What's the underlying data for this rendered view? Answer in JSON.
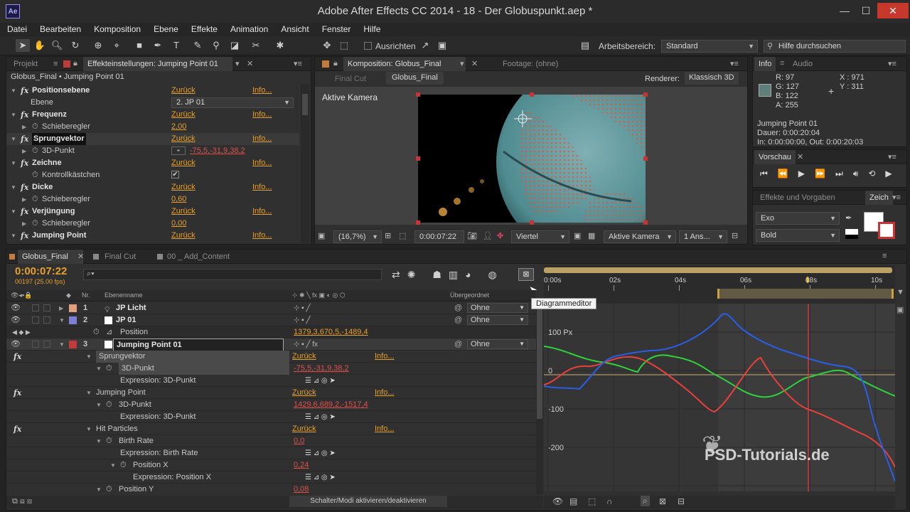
{
  "window": {
    "app_logo": "Ae",
    "title": "Adobe After Effects CC 2014 - 18 - Der Globuspunkt.aep *",
    "minimize": "—",
    "maximize": "☐",
    "close": "✕"
  },
  "menu": [
    "Datei",
    "Bearbeiten",
    "Komposition",
    "Ebene",
    "Effekte",
    "Animation",
    "Ansicht",
    "Fenster",
    "Hilfe"
  ],
  "toolbar": {
    "ausrichten_label": "Ausrichten",
    "arbeitsbereich_label": "Arbeitsbereich:",
    "arbeitsbereich_value": "Standard",
    "search_placeholder": "Hilfe durchsuchen"
  },
  "effects_panel": {
    "tab_projekt": "Projekt",
    "tab_effekteinstellungen": "Effekteinstellungen: Jumping Point 01",
    "breadcrumb": "Globus_Final • Jumping Point 01",
    "rows": [
      {
        "kind": "fx",
        "name": "Positionsebene",
        "reset": "Zurück",
        "info": "Info..."
      },
      {
        "kind": "prop",
        "name": "Ebene",
        "value": "2. JP 01"
      },
      {
        "kind": "fx",
        "name": "Frequenz",
        "reset": "Zurück",
        "info": "Info..."
      },
      {
        "kind": "sub",
        "name": "Schieberegler",
        "value": "2,00"
      },
      {
        "kind": "fx",
        "name": "Sprungvektor",
        "reset": "Zurück",
        "info": "Info..."
      },
      {
        "kind": "sub",
        "name": "3D-Punkt",
        "value": "-75,5,-31,9,38,2"
      },
      {
        "kind": "fx",
        "name": "Zeichne",
        "reset": "Zurück",
        "info": "Info..."
      },
      {
        "kind": "sub",
        "name": "Kontrollkästchen",
        "value": "✔"
      },
      {
        "kind": "fx",
        "name": "Dicke",
        "reset": "Zurück",
        "info": "Info..."
      },
      {
        "kind": "sub",
        "name": "Schieberegler",
        "value": "0,60"
      },
      {
        "kind": "fx",
        "name": "Verjüngung",
        "reset": "Zurück",
        "info": "Info..."
      },
      {
        "kind": "sub",
        "name": "Schieberegler",
        "value": "0,00"
      },
      {
        "kind": "fx",
        "name": "Jumping Point",
        "reset": "Zurück",
        "info": "Info..."
      }
    ]
  },
  "comp_panel": {
    "tab_komposition": "Komposition: Globus_Final",
    "tab_footage": "Footage: (ohne)",
    "crumb_final_cut": "Final Cut",
    "crumb_globus": "Globus_Final",
    "renderer_label": "Renderer:",
    "renderer_value": "Klassisch 3D",
    "active_camera_label": "Aktive Kamera",
    "zoom": "(16,7%)",
    "timecode": "0:00:07:22",
    "resolution": "Viertel",
    "camera": "Aktive Kamera",
    "views": "1 Ans..."
  },
  "info_panel": {
    "tab_info": "Info",
    "tab_audio": "Audio",
    "r": "R:  97",
    "g": "G:  127",
    "b": "B:  122",
    "a": "A:  255",
    "x": "X : 971",
    "y": "Y : 311",
    "swatch_color": "#617f7a",
    "layer_name": "Jumping Point 01",
    "dauer": "Dauer: 0:00:20:04",
    "in_out": "In: 0:00:00:00,  Out: 0:00:20:03"
  },
  "preview_panel": {
    "tab": "Vorschau"
  },
  "char_panel": {
    "tab_effects": "Effekte und Vorgaben",
    "tab_zeichen": "Zeich",
    "font": "Exo",
    "style": "Bold"
  },
  "timeline": {
    "tabs": [
      "Globus_Final",
      "Final Cut",
      "00 _ Add_Content"
    ],
    "timecode": "0:00:07:22",
    "frames": "00197 (25.00 fps)",
    "search_placeholder": "⌕▾",
    "col_nr": "Nr.",
    "col_name": "Ebenenname",
    "col_parent": "Übergeordnet",
    "tooltip": "Diagrammeditor",
    "bottom_toggle": "Schalter/Modi aktivieren/deaktivieren",
    "layers": [
      {
        "nr": "1",
        "name": "JP Licht",
        "color": "#e0a080",
        "parent": "Ohne"
      },
      {
        "nr": "2",
        "name": "JP 01",
        "color": "#7b7fd6",
        "parent": "Ohne"
      },
      {
        "nr": "3",
        "name": "Jumping Point 01",
        "color": "#c23b3b",
        "parent": "Ohne"
      }
    ],
    "position_label": "Position",
    "position_value": "1379,3,670,5,-1489,4",
    "props": [
      {
        "indent": 1,
        "kind": "fx",
        "name": "Sprungvektor",
        "reset": "Zurück",
        "info": "Info..."
      },
      {
        "indent": 2,
        "kind": "prop",
        "name": "3D-Punkt",
        "value": "-75,5,-31,9,38,2"
      },
      {
        "indent": 3,
        "kind": "expr",
        "name": "Expression: 3D-Punkt"
      },
      {
        "indent": 1,
        "kind": "fx",
        "name": "Jumping Point",
        "reset": "Zurück",
        "info": "Info..."
      },
      {
        "indent": 2,
        "kind": "prop",
        "name": "3D-Punkt",
        "value": "1429,6,689,2,-1517,4"
      },
      {
        "indent": 3,
        "kind": "expr",
        "name": "Expression: 3D-Punkt"
      },
      {
        "indent": 1,
        "kind": "fx",
        "name": "Hit Particles",
        "reset": "Zurück",
        "info": "Info..."
      },
      {
        "indent": 2,
        "kind": "prop",
        "name": "Birth Rate",
        "value": "0,0"
      },
      {
        "indent": 3,
        "kind": "expr",
        "name": "Expression: Birth Rate"
      },
      {
        "indent": 2,
        "kind": "prop",
        "name": "Position X",
        "value": "0,24"
      },
      {
        "indent": 4,
        "kind": "expr",
        "name": "Expression: Position X"
      },
      {
        "indent": 2,
        "kind": "prop",
        "name": "Position Y",
        "value": "0,08"
      }
    ]
  },
  "graph": {
    "ruler": [
      "0:00s",
      "02s",
      "04s",
      "06s",
      "08s",
      "10s"
    ],
    "y_labels": [
      "100 Px",
      "0",
      "-100",
      "-200"
    ],
    "watermark": "PSD-Tutorials.de",
    "colors": {
      "red": "#e8403c",
      "green": "#2fd23b",
      "blue": "#2a5ee6",
      "playhead": "#d13a3a"
    }
  }
}
